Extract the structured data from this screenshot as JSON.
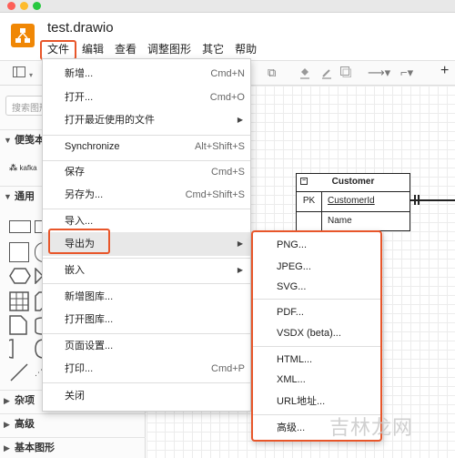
{
  "window": {
    "doc_title": "test.drawio"
  },
  "menubar": [
    "文件",
    "编辑",
    "查看",
    "调整图形",
    "其它",
    "帮助"
  ],
  "sidebar": {
    "search_placeholder": "搜索图形",
    "sections": {
      "scratchpad": "便笺本",
      "general": "通用",
      "misc": "杂项",
      "advanced": "高级",
      "basic": "基本图形"
    },
    "kafka_label": "kafka"
  },
  "canvas": {
    "entity": {
      "title": "Customer",
      "rows": [
        {
          "key": "PK",
          "field": "CustomerId"
        },
        {
          "key": "",
          "field": "Name"
        }
      ]
    }
  },
  "file_menu": {
    "items": [
      {
        "label": "新增...",
        "shortcut": "Cmd+N"
      },
      {
        "label": "打开...",
        "shortcut": "Cmd+O"
      },
      {
        "label": "打开最近使用的文件",
        "arrow": "▶"
      },
      {
        "label": "Synchronize",
        "shortcut": "Alt+Shift+S"
      },
      {
        "label": "保存",
        "shortcut": "Cmd+S"
      },
      {
        "label": "另存为...",
        "shortcut": "Cmd+Shift+S"
      },
      {
        "label": "导入..."
      },
      {
        "label": "导出为",
        "arrow": "▶"
      },
      {
        "label": "嵌入",
        "arrow": "▶"
      },
      {
        "label": "新增图库..."
      },
      {
        "label": "打开图库..."
      },
      {
        "label": "页面设置..."
      },
      {
        "label": "打印...",
        "shortcut": "Cmd+P"
      },
      {
        "label": "关闭"
      }
    ]
  },
  "export_menu": {
    "items": [
      "PNG...",
      "JPEG...",
      "SVG...",
      "PDF...",
      "VSDX (beta)...",
      "HTML...",
      "XML...",
      "URL地址...",
      "高级..."
    ]
  },
  "watermark": "吉林龙网",
  "colors": {
    "accent_highlight": "#e8562a",
    "logo": "#f08705"
  }
}
